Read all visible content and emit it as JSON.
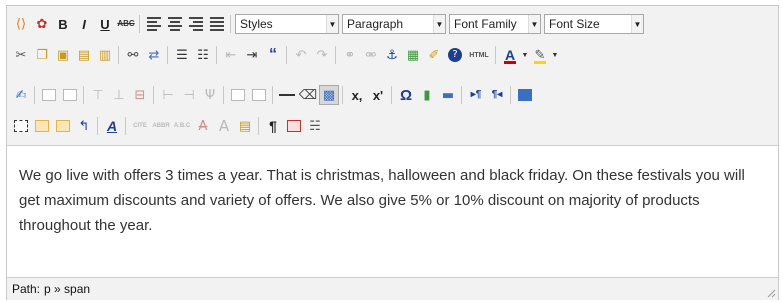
{
  "toolbar": {
    "styles_select": "Styles",
    "paragraph_select": "Paragraph",
    "font_family_select": "Font Family",
    "font_size_select": "Font Size",
    "bold_glyph": "B",
    "italic_glyph": "I",
    "underline_glyph": "U",
    "strikethrough_glyph": "ABC",
    "blockquote_glyph": "“",
    "html_glyph": "HTML",
    "subscript_glyph": "x,",
    "superscript_glyph": "x'",
    "omega_glyph": "Ω",
    "visual_aid_glyph": "A",
    "pilcrow_glyph": "¶",
    "text_color_glyph": "A"
  },
  "content": {
    "paragraph": "We go live with offers 3 times a year. That is christmas, halloween and black friday. On these festivals you will get maximum discounts and variety of offers. We also give 5% or 10% discount on majority of products throughout the year."
  },
  "statusbar": {
    "path_label": "Path:",
    "path_value": "p » span"
  },
  "colors": {
    "link_blue": "#3b6fc4",
    "help_blue": "#1e3f8f",
    "text_color_bar": "#cc0000",
    "highlight_bar": "#ffd400"
  }
}
